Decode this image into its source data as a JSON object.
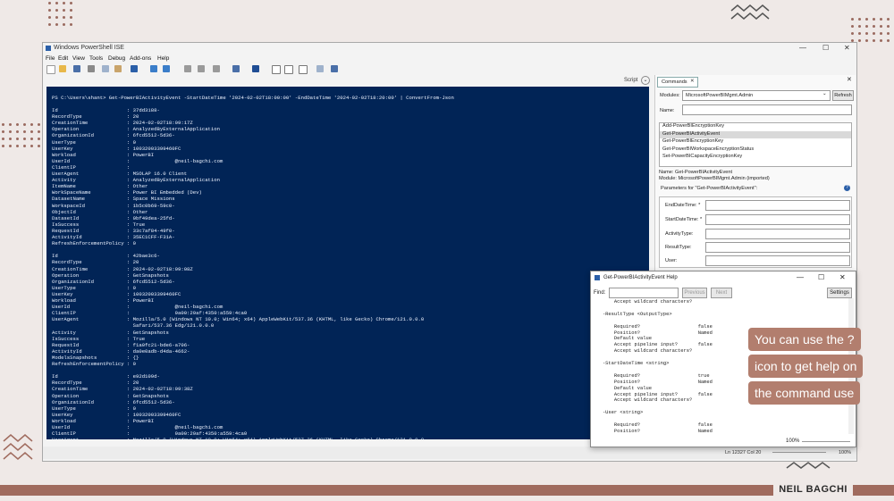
{
  "window": {
    "title": "Windows PowerShell ISE",
    "controls": [
      "—",
      "☐",
      "✕"
    ]
  },
  "menu": [
    "File",
    "Edit",
    "View",
    "Tools",
    "Debug",
    "Add-ons",
    "Help"
  ],
  "script_bar": {
    "label": "Script"
  },
  "console": {
    "prompt": "PS C:\\Users\\shant> Get-PowerBIActivityEvent -StartDateTime '2024-02-02T18:00:00' -EndDateTime '2024-02-02T18:20:00' | ConvertFrom-Json",
    "lines": [
      "Id                       : 37dd3188-",
      "RecordType               : 20",
      "CreationTime             : 2024-02-02T18:09:17Z",
      "Operation                : AnalyzedByExternalApplication",
      "OrganizationId           : 6fcd5512-5d36-",
      "UserType                 : 0",
      "UserKey                  : 10032003399460FC",
      "Workload                 : PowerBI",
      "UserId                   :               @neil-bagchi.com",
      "ClientIP                 :",
      "UserAgent                : MSOLAP 16.0 Client",
      "Activity                 : AnalyzedByExternalApplication",
      "ItemName                 : Other",
      "WorkSpaceName            : Power BI Embedded (Dev)",
      "DatasetName              : Space Missions",
      "WorkspaceId              : 1b5c0b69-59c0-",
      "ObjectId                 : Other",
      "DatasetId                : 0bf49dea-25fd-",
      "IsSuccess                : True",
      "RequestId                : 33c7af84-49f0-",
      "ActivityId               : 35EC1CFF-F31A-",
      "RefreshEnforcementPolicy : 0",
      "",
      "Id                       : 42bae3c6-",
      "RecordType               : 20",
      "CreationTime             : 2024-02-02T18:09:08Z",
      "Operation                : GetSnapshots",
      "OrganizationId           : 6fcd5512-5d36-",
      "UserType                 : 0",
      "UserKey                  : 10032003399460FC",
      "Workload                 : PowerBI",
      "UserId                   :               @neil-bagchi.com",
      "ClientIP                 :               9a00:29af:4350:a559:4ca0",
      "UserAgent                : Mozilla/5.0 (Windows NT 10.0; Win64; x64) AppleWebKit/537.36 (KHTML, like Gecko) Chrome/121.0.0.0",
      "                           Safari/537.36 Edg/121.0.0.0",
      "Activity                 : GetSnapshots",
      "IsSuccess                : True",
      "RequestId                : f1a0fc21-bde6-a706-",
      "ActivityId               : da0e0adb-d4da-4662-",
      "ModelsSnapshots          : {}",
      "RefreshEnforcementPolicy : 0",
      "",
      "Id                       : e92d109d-",
      "RecordType               : 20",
      "CreationTime             : 2024-02-02T18:09:38Z",
      "Operation                : GetSnapshots",
      "OrganizationId           : 6fcd5512-5d36-",
      "UserType                 : 0",
      "UserKey                  : 10032003399460FC",
      "Workload                 : PowerBI",
      "UserId                   :               @neil-bagchi.com",
      "ClientIP                 :               9a00:29af:4350:a559:4ca0",
      "UserAgent                : Mozilla/5.0 (Windows NT 10.0; Win64; x64) AppleWebKit/537.36 (KHTML, like Gecko) Chrome/121.0.0.0",
      "                           Safari/537.36 Edg/121.0.0.0",
      "Activity                 : GetSnapshots"
    ]
  },
  "commands": {
    "tab_label": "Commands",
    "modules_label": "Modules:",
    "modules_value": "MicrosoftPowerBIMgmt.Admin",
    "refresh_label": "Refresh",
    "name_label": "Name:",
    "list": [
      "Add-PowerBIEncryptionKey",
      "Get-PowerBIActivityEvent",
      "Get-PowerBIEncryptionKey",
      "Get-PowerBIWorkspaceEncryptionStatus",
      "Set-PowerBICapacityEncryptionKey"
    ],
    "selected_name": "Name: Get-PowerBIActivityEvent",
    "selected_module": "Module: MicrosoftPowerBIMgmt.Admin (imported)",
    "params_heading": "Parameters for \"Get-PowerBIActivityEvent\":",
    "params": [
      "EndDateTime: *",
      "StartDateTime: *",
      "ActivityType:",
      "ResultType:",
      "User:"
    ]
  },
  "help": {
    "title": "Get-PowerBIActivityEvent Help",
    "find_label": "Find:",
    "previous_label": "Previous",
    "next_label": "Next",
    "settings_label": "Settings",
    "lines": [
      "        Accept wildcard characters?",
      "",
      "    -ResultType <OutputType>",
      "",
      "        Required?                    false",
      "        Position?                    Named",
      "        Default value",
      "        Accept pipeline input?       false",
      "        Accept wildcard characters?",
      "",
      "    -StartDateTime <string>",
      "",
      "        Required?                    true",
      "        Position?                    Named",
      "        Default value",
      "        Accept pipeline input?       false",
      "        Accept wildcard characters?",
      "",
      "    -User <string>",
      "",
      "        Required?                    false",
      "        Position?                    Named"
    ],
    "zoom": "100%"
  },
  "status": {
    "position": "Ln 12327  Col 20",
    "zoom": "100%"
  },
  "callout": [
    "You can use the ?",
    "icon to get help on",
    "the command use"
  ],
  "author": "NEIL BAGCHI"
}
